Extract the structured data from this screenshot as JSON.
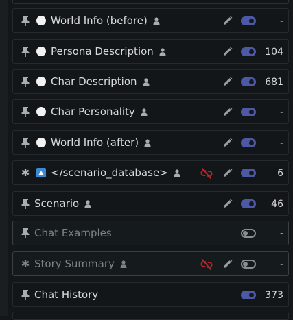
{
  "prompts": [
    {
      "name": "World Info (before)",
      "leading_icon": "pin-icon",
      "marker": "circle",
      "user_icon": true,
      "link_broken": false,
      "editable": true,
      "enabled": true,
      "tokens": "-",
      "disabled_row": false
    },
    {
      "name": "Persona Description",
      "leading_icon": "pin-icon",
      "marker": "circle",
      "user_icon": true,
      "link_broken": false,
      "editable": true,
      "enabled": true,
      "tokens": "104",
      "disabled_row": false
    },
    {
      "name": "Char Description",
      "leading_icon": "pin-icon",
      "marker": "circle",
      "user_icon": true,
      "link_broken": false,
      "editable": true,
      "enabled": true,
      "tokens": "681",
      "disabled_row": false
    },
    {
      "name": "Char Personality",
      "leading_icon": "pin-icon",
      "marker": "circle",
      "user_icon": true,
      "link_broken": false,
      "editable": true,
      "enabled": true,
      "tokens": "-",
      "disabled_row": false
    },
    {
      "name": "World Info (after)",
      "leading_icon": "pin-icon",
      "marker": "circle",
      "user_icon": true,
      "link_broken": false,
      "editable": true,
      "enabled": true,
      "tokens": "-",
      "disabled_row": false
    },
    {
      "name": "</scenario_database>",
      "leading_icon": "asterisk-icon",
      "marker": "triangle-box",
      "user_icon": true,
      "link_broken": true,
      "editable": true,
      "enabled": true,
      "tokens": "6",
      "disabled_row": false
    },
    {
      "name": "Scenario",
      "leading_icon": "pin-icon",
      "marker": "none",
      "user_icon": true,
      "link_broken": false,
      "editable": true,
      "enabled": true,
      "tokens": "46",
      "disabled_row": false
    },
    {
      "name": "Chat Examples",
      "leading_icon": "pin-icon",
      "marker": "none",
      "user_icon": false,
      "link_broken": false,
      "editable": false,
      "enabled": false,
      "tokens": "-",
      "disabled_row": true
    },
    {
      "name": "Story Summary",
      "leading_icon": "asterisk-icon",
      "marker": "none",
      "user_icon": true,
      "link_broken": true,
      "editable": true,
      "enabled": false,
      "tokens": "-",
      "disabled_row": true
    },
    {
      "name": "Chat History",
      "leading_icon": "pin-icon",
      "marker": "none",
      "user_icon": false,
      "link_broken": false,
      "editable": false,
      "enabled": true,
      "tokens": "373",
      "disabled_row": false
    }
  ],
  "colors": {
    "background": "#13171a",
    "row_border": "#242a2e",
    "toggle_on": "#4e59a6",
    "toggle_off": "#8a8e91",
    "broken_link": "#b3262b",
    "marker_blue": "#3c88d6"
  }
}
